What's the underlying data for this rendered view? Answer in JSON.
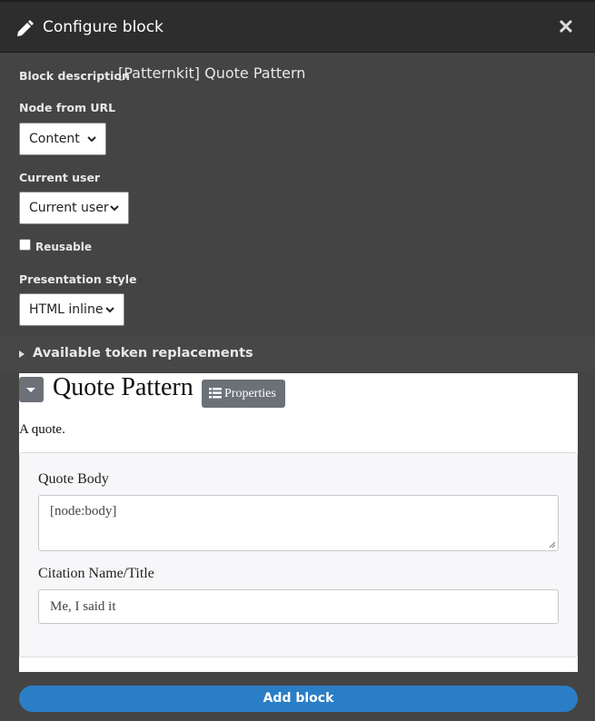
{
  "dialog": {
    "title": "Configure block",
    "title_icon": "pencil-icon",
    "close_glyph": "✕"
  },
  "form": {
    "block_description_label": "Block description",
    "block_description_value": "[Patternkit] Quote Pattern",
    "node_from_url": {
      "label": "Node from URL",
      "selected": "Content"
    },
    "current_user": {
      "label": "Current user",
      "selected": "Current user"
    },
    "reusable": {
      "label": "Reusable",
      "checked": false
    },
    "presentation_style": {
      "label": "Presentation style",
      "selected": "HTML inline"
    },
    "token_replacements": "Available token replacements"
  },
  "pattern": {
    "title": "Quote Pattern",
    "properties_label": "Properties",
    "description": "A quote.",
    "fields": {
      "quote_body_label": "Quote Body",
      "quote_body_value": "[node:body]",
      "citation_label": "Citation Name/Title",
      "citation_value": "Me, I said it"
    }
  },
  "footer": {
    "add_block_label": "Add block"
  },
  "colors": {
    "dialog_bg": "#444444",
    "titlebar_bg": "#2d2d2d",
    "primary_button": "#2a7ec6",
    "secondary_button": "#6b7177"
  }
}
